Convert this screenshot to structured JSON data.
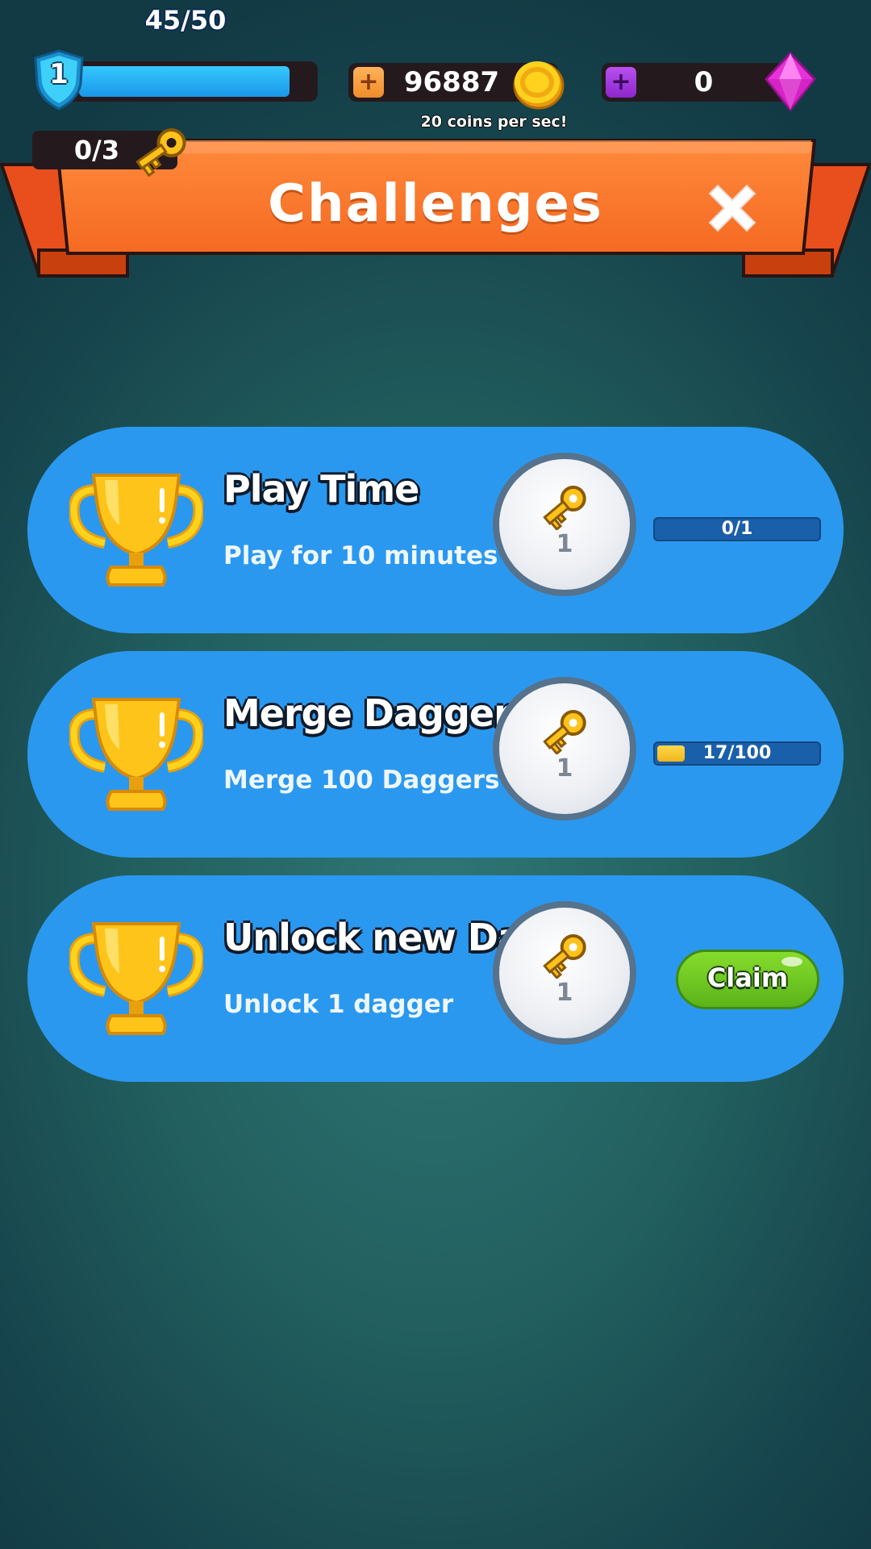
{
  "hud": {
    "level": "1",
    "xp_text": "45/50",
    "xp_progress": 0.9,
    "coins": "96887",
    "coin_rate": "20 coins per sec!",
    "gems": "0",
    "keys_text": "0/3"
  },
  "screen": {
    "title": "Challenges"
  },
  "challenges": [
    {
      "title": "Play Time",
      "description": "Play for 10 minutes",
      "reward_count": "1",
      "progress_text": "0/1",
      "progress": 0.0
    },
    {
      "title": "Merge Daggers",
      "description": "Merge 100 Daggers",
      "reward_count": "1",
      "progress_text": "17/100",
      "progress": 0.17
    },
    {
      "title": "Unlock new Dagger",
      "description": "Unlock 1 dagger",
      "reward_count": "1",
      "claim_label": "Claim"
    }
  ],
  "icons": {
    "level": "shield-icon",
    "coins": "coin-icon",
    "gems": "gem-icon",
    "keys": "key-icon",
    "close": "close-icon",
    "challenge": "trophy-icon"
  },
  "colors": {
    "card": "#2b98ef",
    "banner": "#ff7b2e",
    "claim": "#6cc422",
    "xp_fill": "#27b4f8",
    "progress_fill": "#f7c52a"
  }
}
